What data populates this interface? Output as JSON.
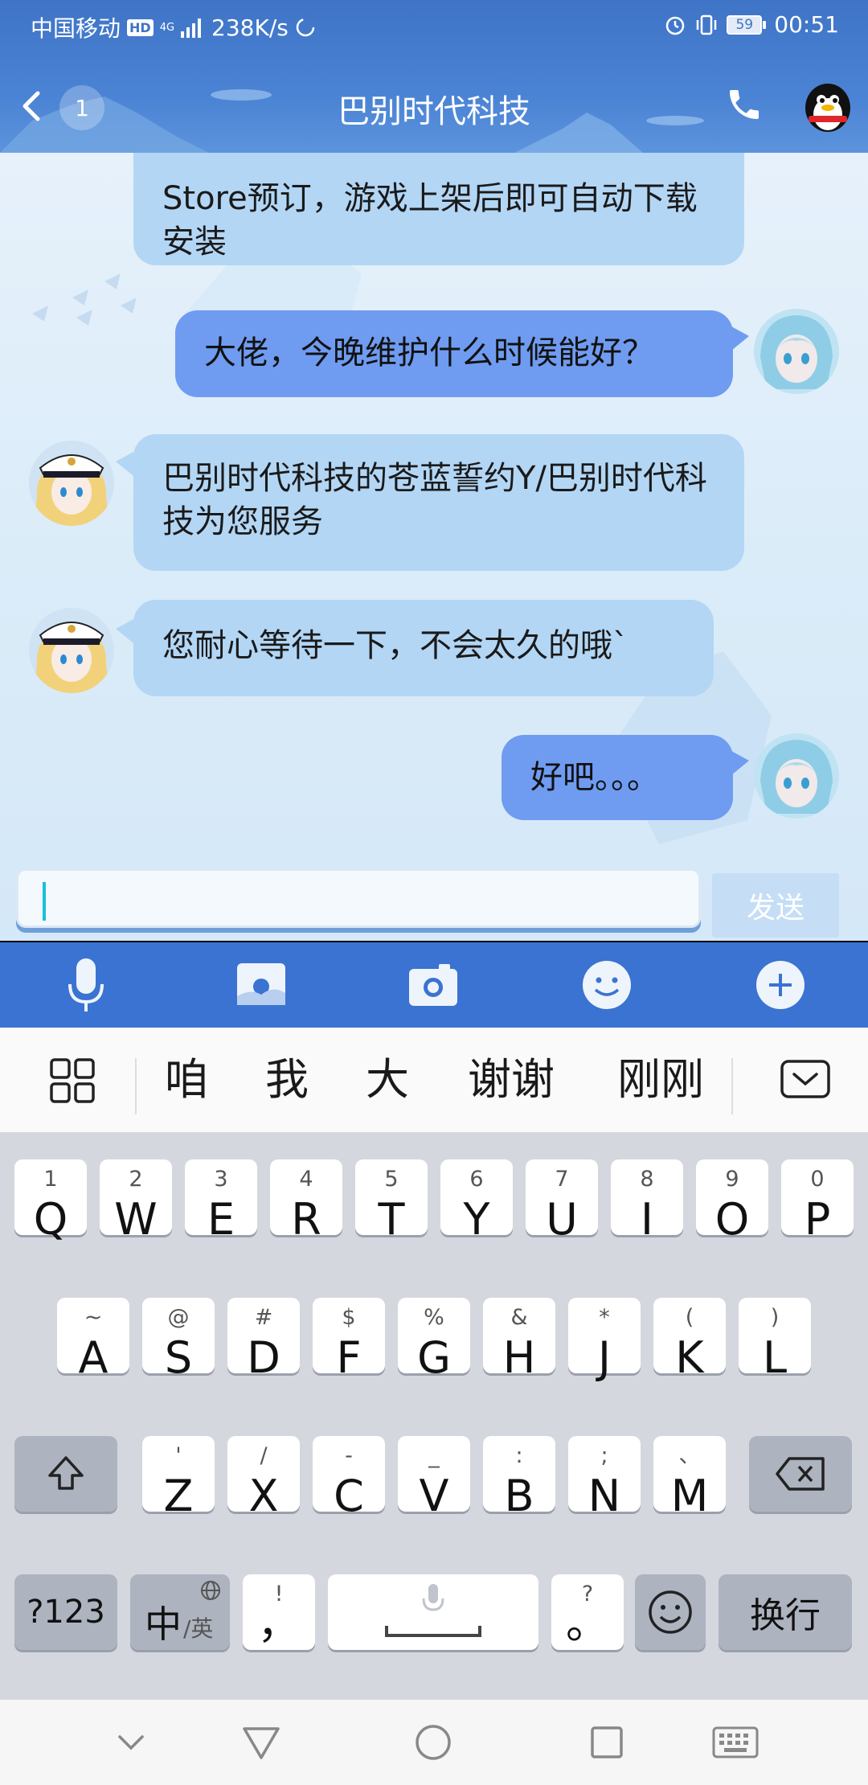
{
  "status_bar": {
    "carrier": "中国移动",
    "hd": "HD",
    "network": "4G",
    "speed": "238K/s",
    "battery": "59",
    "time": "00:51"
  },
  "header": {
    "unread_count": "1",
    "title": "巴别时代科技"
  },
  "messages": [
    {
      "side": "incoming",
      "text": "Store预订，游戏上架后即可自动下载安装"
    },
    {
      "side": "outgoing",
      "text": "大佬，今晚维护什么时候能好？"
    },
    {
      "side": "incoming",
      "text": "巴别时代科技的苍蓝誓约Y/巴别时代科技为您服务"
    },
    {
      "side": "incoming",
      "text": "您耐心等待一下，不会太久的哦`"
    },
    {
      "side": "outgoing",
      "text": "好吧。。。"
    }
  ],
  "input": {
    "value": "",
    "send_label": "发送"
  },
  "toolbar": {
    "items": [
      "microphone-icon",
      "image-icon",
      "camera-icon",
      "emoji-icon",
      "plus-icon"
    ]
  },
  "suggestions": {
    "words": [
      "咱",
      "我",
      "大",
      "谢谢",
      "刚刚"
    ]
  },
  "keyboard": {
    "row1": [
      {
        "main": "Q",
        "sub": "1"
      },
      {
        "main": "W",
        "sub": "2"
      },
      {
        "main": "E",
        "sub": "3"
      },
      {
        "main": "R",
        "sub": "4"
      },
      {
        "main": "T",
        "sub": "5"
      },
      {
        "main": "Y",
        "sub": "6"
      },
      {
        "main": "U",
        "sub": "7"
      },
      {
        "main": "I",
        "sub": "8"
      },
      {
        "main": "O",
        "sub": "9"
      },
      {
        "main": "P",
        "sub": "0"
      }
    ],
    "row2": [
      {
        "main": "A",
        "sub": "~"
      },
      {
        "main": "S",
        "sub": "@"
      },
      {
        "main": "D",
        "sub": "#"
      },
      {
        "main": "F",
        "sub": "$"
      },
      {
        "main": "G",
        "sub": "%"
      },
      {
        "main": "H",
        "sub": "&"
      },
      {
        "main": "J",
        "sub": "*"
      },
      {
        "main": "K",
        "sub": "("
      },
      {
        "main": "L",
        "sub": ")"
      }
    ],
    "row3": [
      {
        "main": "Z",
        "sub": "'"
      },
      {
        "main": "X",
        "sub": "/"
      },
      {
        "main": "C",
        "sub": "-"
      },
      {
        "main": "V",
        "sub": "_"
      },
      {
        "main": "B",
        "sub": ":"
      },
      {
        "main": "N",
        "sub": ";"
      },
      {
        "main": "M",
        "sub": "、"
      }
    ],
    "sym_label": "?123",
    "lang_main": "中",
    "lang_sub": "/英",
    "comma_main": "，",
    "comma_sub": "!",
    "period_main": "。",
    "period_sub": "?",
    "enter_label": "换行"
  }
}
